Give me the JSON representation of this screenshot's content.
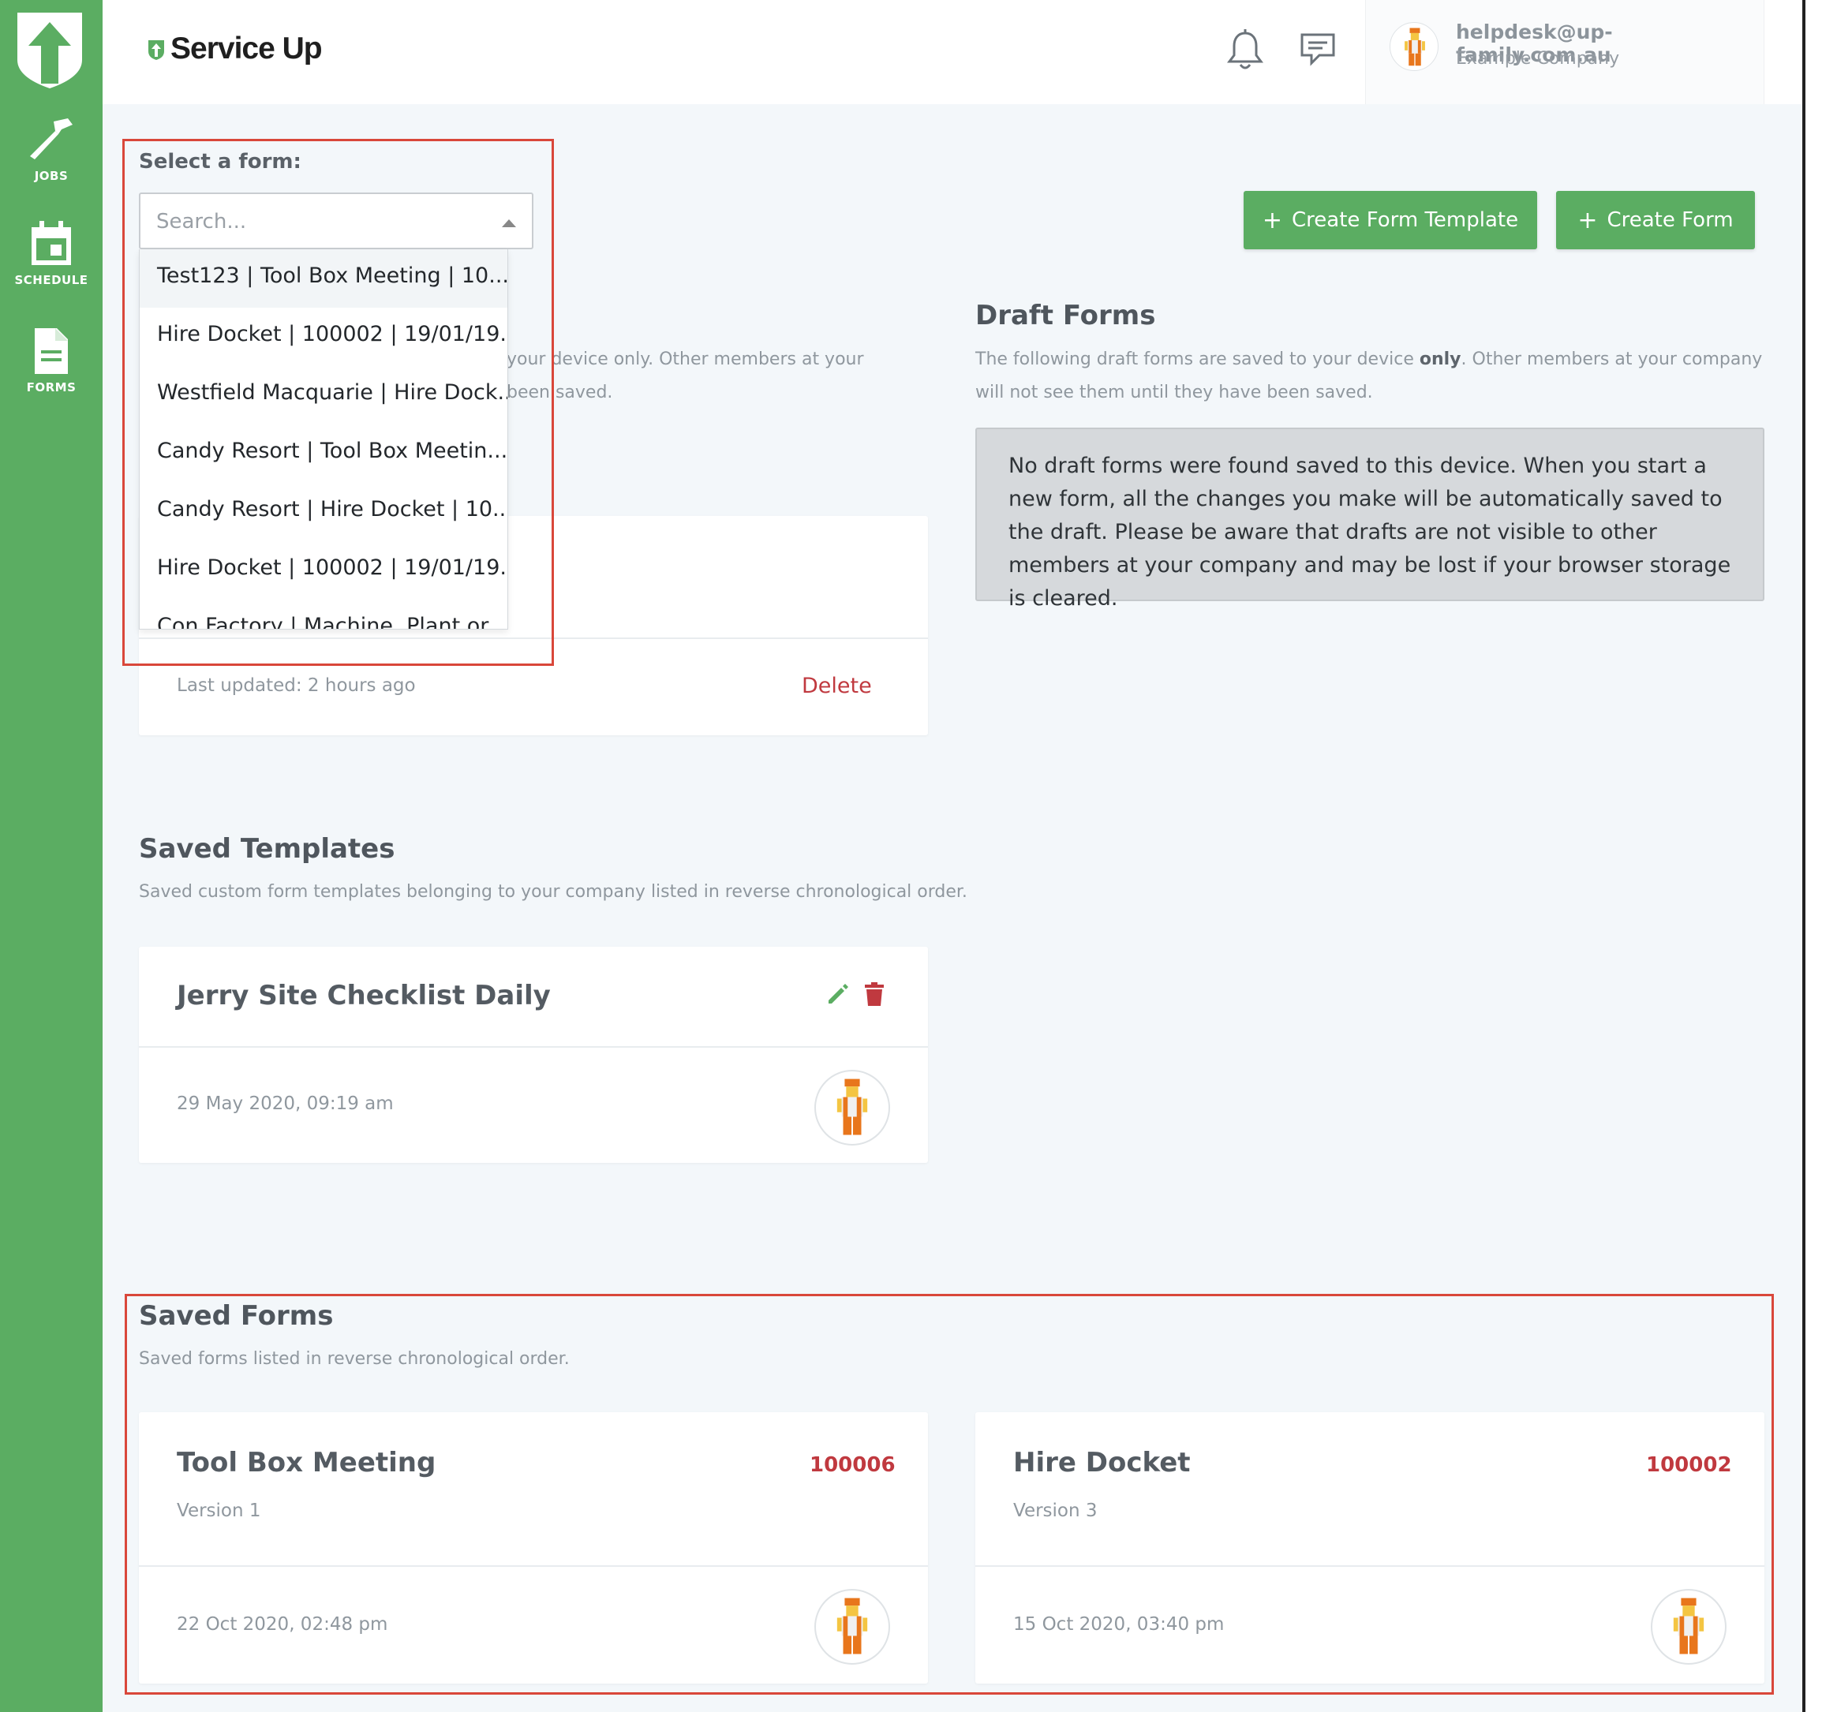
{
  "brand": {
    "name": "Service Up"
  },
  "sidebar": {
    "items": [
      {
        "label": "JOBS",
        "icon": "hammer-icon"
      },
      {
        "label": "SCHEDULE",
        "icon": "calendar-icon"
      },
      {
        "label": "FORMS",
        "icon": "document-icon"
      }
    ]
  },
  "header": {
    "user_email": "helpdesk@up-family.com.au",
    "user_company": "Example Company"
  },
  "select_form": {
    "label": "Select a form:",
    "placeholder": "Search...",
    "options": [
      "Test123 | Tool Box Meeting | 10...",
      "Hire Docket | 100002 | 19/01/19...",
      "Westfield Macquarie | Hire Dock...",
      "Candy Resort | Tool Box Meetin...",
      "Candy Resort | Hire Docket | 10...",
      "Hire Docket | 100002 | 19/01/19...",
      "Con Factory | Machine, Plant or..."
    ]
  },
  "buttons": {
    "create_template": "Create Form Template",
    "create_form": "Create Form",
    "plus": "+"
  },
  "left_drafts": {
    "sub_line1": "your device only. Other members at your",
    "sub_line2": "been saved.",
    "card": {
      "last_updated": "Last updated: 2 hours ago",
      "delete_label": "Delete"
    }
  },
  "draft_forms": {
    "title": "Draft Forms",
    "desc_pre": "The following draft forms are saved to your device ",
    "desc_bold": "only",
    "desc_post": ". Other members at your company",
    "desc_line2": "will not see them until they have been saved.",
    "notice": "No draft forms were found saved to this device. When you start a new form, all the changes you make will be automatically saved to the draft. Please be aware that drafts are not visible to other members at your company and may be lost if your browser storage is cleared."
  },
  "saved_templates": {
    "title": "Saved Templates",
    "desc": "Saved custom form templates belonging to your company listed in reverse chronological order.",
    "items": [
      {
        "name": "Jerry Site Checklist Daily",
        "date": "29 May 2020, 09:19 am"
      }
    ]
  },
  "saved_forms": {
    "title": "Saved Forms",
    "desc": "Saved forms listed in reverse chronological order.",
    "items": [
      {
        "name": "Tool Box Meeting",
        "number": "100006",
        "version": "Version 1",
        "date": "22 Oct 2020, 02:48 pm"
      },
      {
        "name": "Hire Docket",
        "number": "100002",
        "version": "Version 3",
        "date": "15 Oct 2020, 03:40 pm"
      }
    ]
  },
  "colors": {
    "brand_green": "#5bad62",
    "danger_red": "#c0393f",
    "highlight_red": "#d9473a"
  }
}
